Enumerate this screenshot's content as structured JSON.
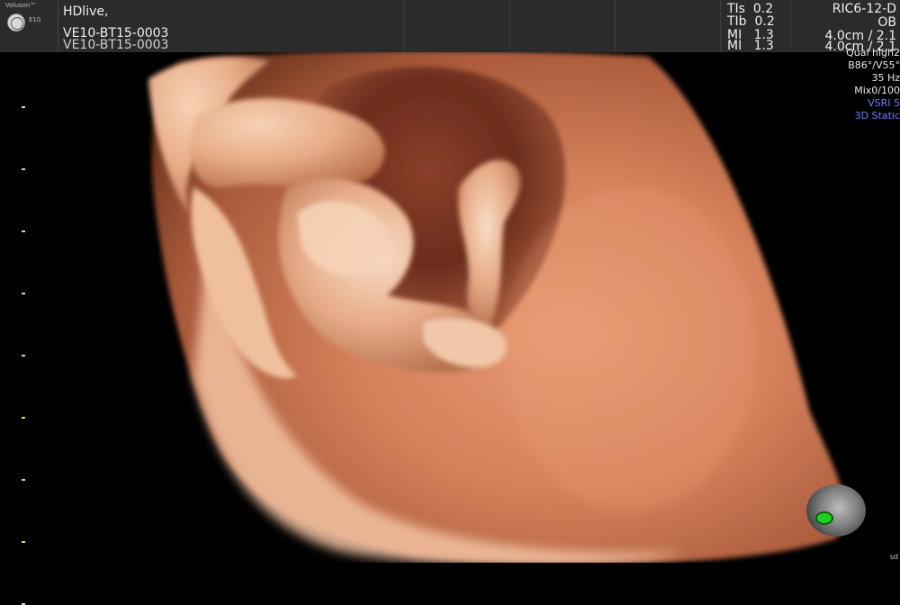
{
  "header": {
    "brand": "Voluson™",
    "model": "E10",
    "mode": "HDlive,",
    "probe_id": "VE10-BT15-0003",
    "indices": [
      {
        "label": "TIs",
        "value": "0.2"
      },
      {
        "label": "TIb",
        "value": "0.2"
      },
      {
        "label": "MI",
        "value": "1.3"
      },
      {
        "label": "MI",
        "value": "1.3"
      }
    ],
    "probe": {
      "name": "RIC6-12-D",
      "preset": "OB",
      "depth": "4.0cm / 2.1",
      "depth_repeat": "4.0cm / 2.1"
    }
  },
  "params": {
    "lines": [
      "Qual high2",
      "B86°/V55°",
      "35 Hz",
      "Mix0/100",
      "VSRI 5",
      "3D Static"
    ],
    "accent_color": "#6f7bff"
  },
  "depth_ticks": 9,
  "orientation": {
    "marker_color": "#1fd11f"
  },
  "corner_tag": "sd"
}
